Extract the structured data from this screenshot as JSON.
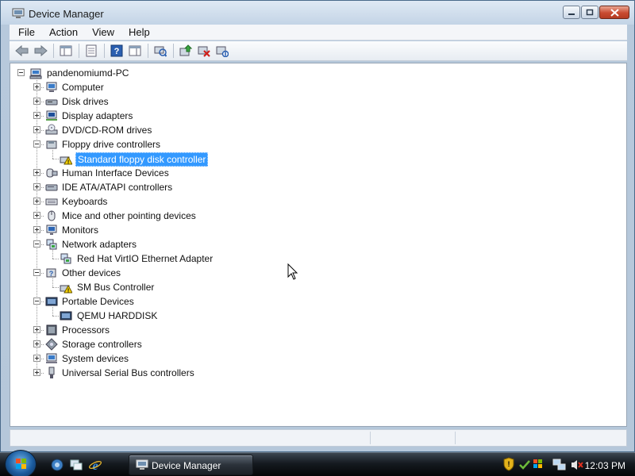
{
  "window": {
    "title": "Device Manager"
  },
  "menu": [
    "File",
    "Action",
    "View",
    "Help"
  ],
  "tree": {
    "root": "pandenomiumd-PC",
    "categories": [
      {
        "label": "Computer",
        "icon": "computer-icon"
      },
      {
        "label": "Disk drives",
        "icon": "disk-drive-icon"
      },
      {
        "label": "Display adapters",
        "icon": "display-adapter-icon"
      },
      {
        "label": "DVD/CD-ROM drives",
        "icon": "dvd-drive-icon"
      },
      {
        "label": "Floppy drive controllers",
        "icon": "floppy-controller-icon",
        "expanded": true,
        "children": [
          {
            "label": "Standard floppy disk controller",
            "icon": "warning-device-icon",
            "selected": true
          }
        ]
      },
      {
        "label": "Human Interface Devices",
        "icon": "hid-icon"
      },
      {
        "label": "IDE ATA/ATAPI controllers",
        "icon": "ide-controller-icon"
      },
      {
        "label": "Keyboards",
        "icon": "keyboard-icon"
      },
      {
        "label": "Mice and other pointing devices",
        "icon": "mouse-icon"
      },
      {
        "label": "Monitors",
        "icon": "monitor-icon"
      },
      {
        "label": "Network adapters",
        "icon": "network-adapter-icon",
        "expanded": true,
        "children": [
          {
            "label": "Red Hat VirtIO Ethernet Adapter",
            "icon": "network-adapter-icon"
          }
        ]
      },
      {
        "label": "Other devices",
        "icon": "other-devices-icon",
        "expanded": true,
        "children": [
          {
            "label": "SM Bus Controller",
            "icon": "warning-device-icon"
          }
        ]
      },
      {
        "label": "Portable Devices",
        "icon": "portable-device-icon",
        "expanded": true,
        "children": [
          {
            "label": "QEMU HARDDISK",
            "icon": "portable-device-icon"
          }
        ]
      },
      {
        "label": "Processors",
        "icon": "processor-icon"
      },
      {
        "label": "Storage controllers",
        "icon": "storage-controller-icon"
      },
      {
        "label": "System devices",
        "icon": "system-devices-icon"
      },
      {
        "label": "Universal Serial Bus controllers",
        "icon": "usb-icon"
      }
    ]
  },
  "taskbar": {
    "task": "Device Manager",
    "clock": "12:03 PM"
  },
  "colors": {
    "selection": "#3399ff",
    "taskbar": "#151a20"
  }
}
